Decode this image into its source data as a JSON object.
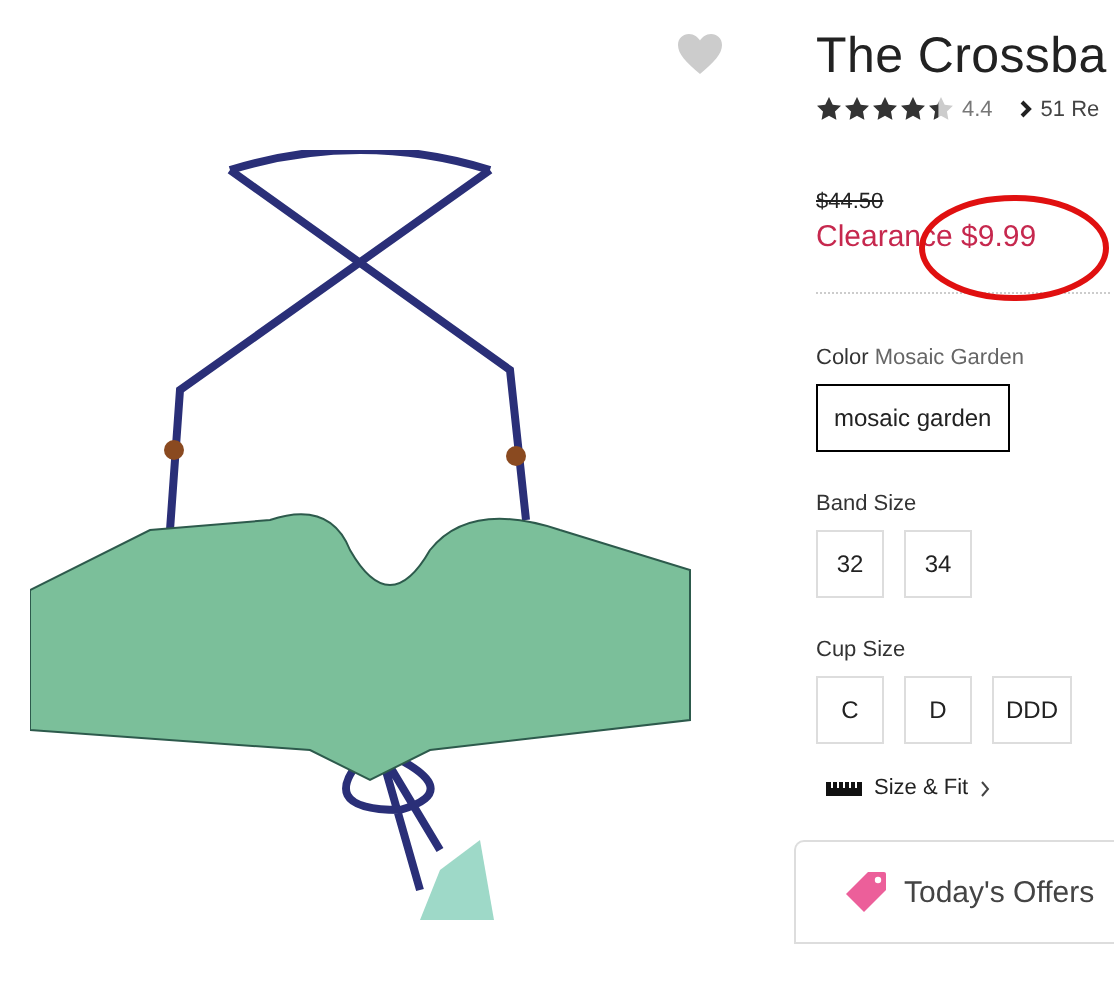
{
  "title": "The Crossba",
  "rating": {
    "stars": 4.4,
    "value": "4.4"
  },
  "reviews_link": "51 Re",
  "price": {
    "original": "$44.50",
    "sale": "Clearance $9.99"
  },
  "color": {
    "label": "Color",
    "value": "Mosaic Garden",
    "options": [
      {
        "label": "mosaic garden",
        "selected": true
      }
    ]
  },
  "band_size": {
    "label": "Band Size",
    "options": [
      {
        "label": "32",
        "selected": false
      },
      {
        "label": "34",
        "selected": false
      }
    ]
  },
  "cup_size": {
    "label": "Cup Size",
    "options": [
      {
        "label": "C",
        "selected": false
      },
      {
        "label": "D",
        "selected": false
      },
      {
        "label": "DDD",
        "selected": false
      }
    ]
  },
  "size_fit_link": "Size & Fit",
  "offers": "Today's Offers"
}
